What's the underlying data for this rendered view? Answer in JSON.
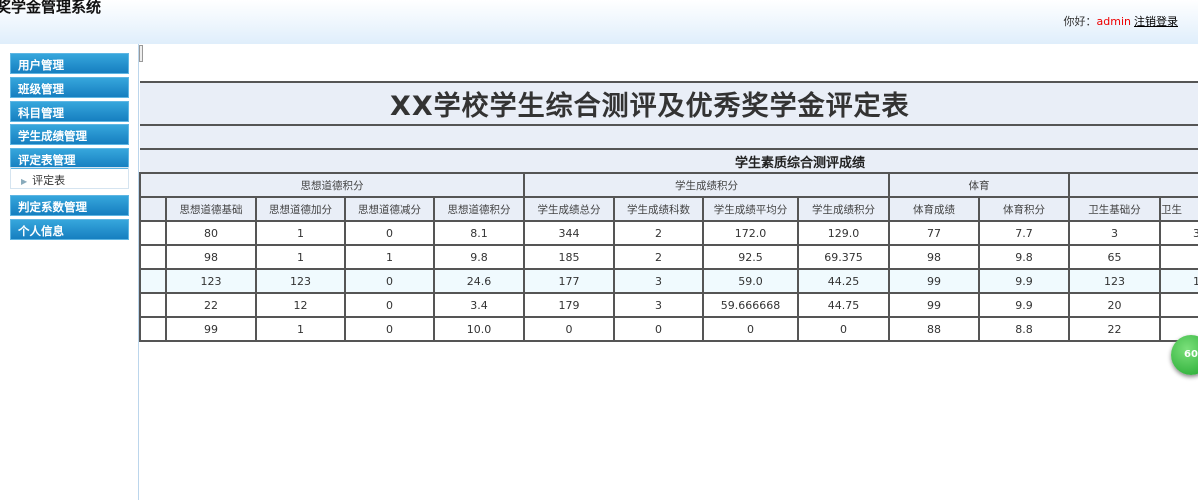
{
  "header": {
    "system_title": "奖学金管理系统",
    "greeting": "你好：",
    "username": "admin",
    "logout": "注销登录"
  },
  "sidebar": {
    "items": [
      "用户管理",
      "班级管理",
      "科目管理",
      "学生成绩管理",
      "评定表管理",
      "判定系数管理",
      "个人信息"
    ],
    "sub_items": [
      "评定表"
    ]
  },
  "table": {
    "title": "XX学校学生综合测评及优秀奖学金评定表",
    "section": "学生素质综合测评成绩",
    "groups": [
      "思想道德积分",
      "学生成绩积分",
      "体育",
      ""
    ],
    "headers": [
      "",
      "思想道德基础",
      "思想道德加分",
      "思想道德减分",
      "思想道德积分",
      "学生成绩总分",
      "学生成绩科数",
      "学生成绩平均分",
      "学生成绩积分",
      "体育成绩",
      "体育积分",
      "卫生基础分",
      "卫生"
    ],
    "rows": [
      [
        "",
        "80",
        "1",
        "0",
        "8.1",
        "344",
        "2",
        "172.0",
        "129.0",
        "77",
        "7.7",
        "3",
        "3"
      ],
      [
        "",
        "98",
        "1",
        "1",
        "9.8",
        "185",
        "2",
        "92.5",
        "69.375",
        "98",
        "9.8",
        "65",
        ""
      ],
      [
        "",
        "123",
        "123",
        "0",
        "24.6",
        "177",
        "3",
        "59.0",
        "44.25",
        "99",
        "9.9",
        "123",
        "1"
      ],
      [
        "",
        "22",
        "12",
        "0",
        "3.4",
        "179",
        "3",
        "59.666668",
        "44.75",
        "99",
        "9.9",
        "20",
        ""
      ],
      [
        "",
        "99",
        "1",
        "0",
        "10.0",
        "0",
        "0",
        "0",
        "0",
        "88",
        "8.8",
        "22",
        ""
      ]
    ]
  },
  "badge": "60"
}
